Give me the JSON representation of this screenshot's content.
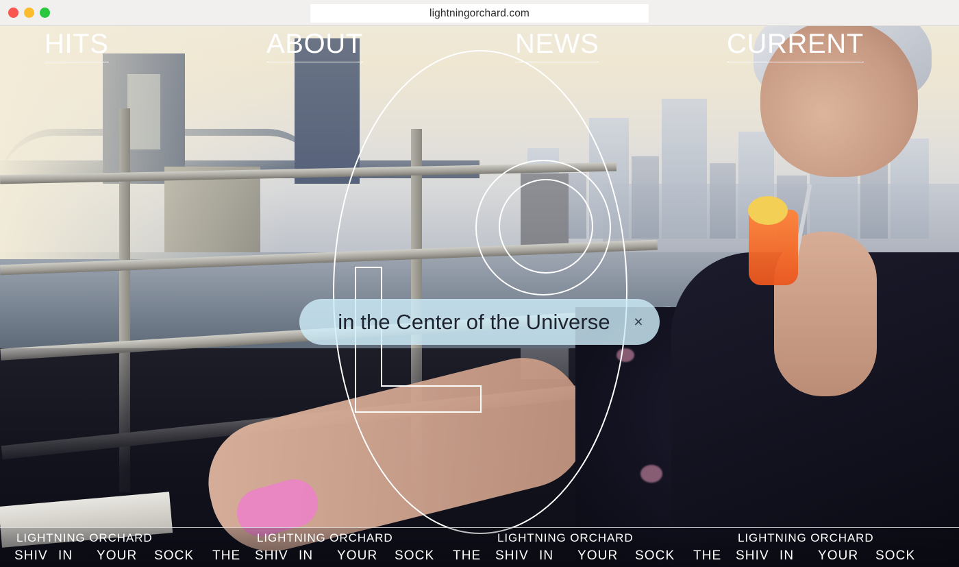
{
  "browser": {
    "url": "lightningorchard.com",
    "traffic_lights": [
      {
        "name": "close",
        "color": "#f8564e"
      },
      {
        "name": "minimize",
        "color": "#fbbd2e"
      },
      {
        "name": "maximize",
        "color": "#2ac83f"
      }
    ]
  },
  "nav": {
    "items": [
      {
        "label": "HITS"
      },
      {
        "label": "ABOUT"
      },
      {
        "label": "NEWS"
      },
      {
        "label": "CURRENT"
      }
    ]
  },
  "logo": {
    "name": "lightning-orchard-lo-monogram",
    "stroke_color": "#ffffff"
  },
  "overlay": {
    "text": "in the Center of the Universe",
    "close_label": "×",
    "background_color": "#cdebf8"
  },
  "ticker": {
    "brand": "LIGHTNING ORCHARD",
    "tagline_words": [
      "THE",
      "SHIV",
      "IN",
      "YOUR",
      "SOCK"
    ],
    "repeat_count": 4
  }
}
